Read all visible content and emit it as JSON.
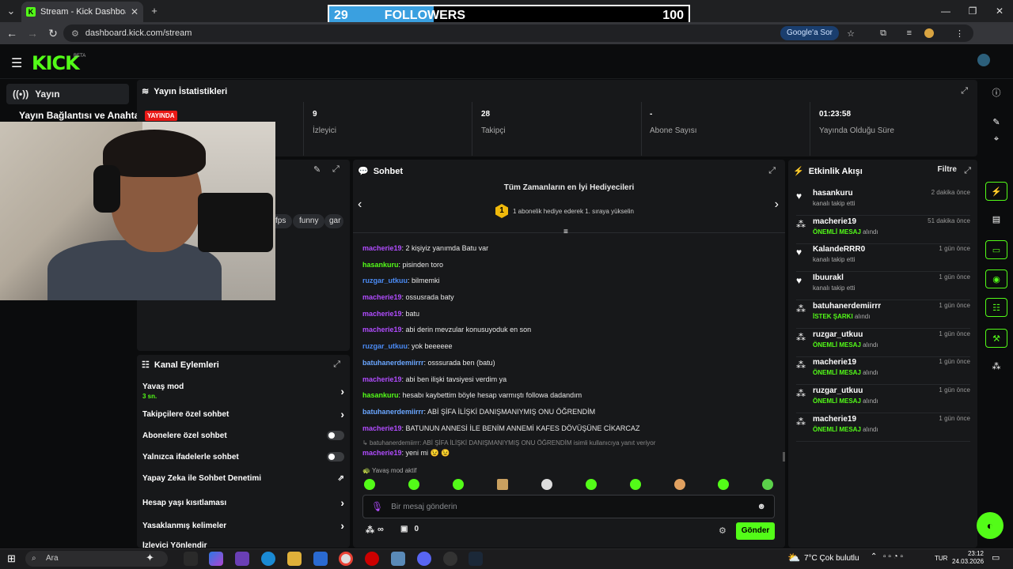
{
  "browser": {
    "tab_title": "Stream - Kick Dashboard",
    "url": "dashboard.kick.com/stream",
    "ask_google": "Google'a Sor"
  },
  "overlay": {
    "current": "29",
    "label": "FOLLOWERS",
    "goal": "100",
    "progress": 0.29
  },
  "kick": {
    "logo": "KICK",
    "beta": "BETA"
  },
  "sidebar": {
    "active": "Yayın",
    "item2": "Yayın Bağlantısı ve Anahtarı"
  },
  "stats": {
    "title": "Yayın İstatistikleri",
    "live_badge": "YAYINDA",
    "viewers_value": "9",
    "viewers_label": "İzleyici",
    "followers_value": "28",
    "followers_label": "Takipçi",
    "subs_value": "-",
    "subs_label": "Abone Sayısı",
    "uptime_value": "01:23:58",
    "uptime_label": "Yayında Olduğu Süre"
  },
  "tags": [
    "fps",
    "funny",
    "gar"
  ],
  "channel_actions": {
    "title": "Kanal Eylemleri",
    "slow_mode": "Yavaş mod",
    "slow_mode_value": "3 sn.",
    "followers_only": "Takipçilere özel sohbet",
    "subs_only": "Abonelere özel sohbet",
    "emotes_only": "Yalnızca ifadelerle sohbet",
    "ai_moderation": "Yapay Zeka ile Sohbet Denetimi",
    "age_restriction": "Hesap yaşı kısıtlaması",
    "banned_words": "Yasaklanmış kelimeler",
    "viewer_management": "İzleyici Yönlendir"
  },
  "chat": {
    "title": "Sohbet",
    "top_gifters": "Tüm Zamanların en İyi Hediyecileri",
    "gift_rank": "1",
    "gift_hint": "1 abonelik hediye ederek 1. sıraya yükselin",
    "messages": [
      {
        "user": "macherie19",
        "text": ": 2 kişiyiz yanımda Batu var",
        "color": "#b14cff"
      },
      {
        "user": "hasankuru",
        "text": ": pisinden toro",
        "color": "#53fc18"
      },
      {
        "user": "ruzgar_utkuu",
        "text": ": bilmemki",
        "color": "#4b8bf5"
      },
      {
        "user": "macherie19",
        "text": ": ossusrada baty",
        "color": "#b14cff"
      },
      {
        "user": "macherie19",
        "text": ": batu",
        "color": "#b14cff"
      },
      {
        "user": "macherie19",
        "text": ": abi derin mevzular konusuyoduk en son",
        "color": "#b14cff"
      },
      {
        "user": "ruzgar_utkuu",
        "text": ": yok beeeeee",
        "color": "#4b8bf5"
      },
      {
        "user": "batuhanerdemiirrr",
        "text": ": osssurada ben (batu)",
        "color": "#6aa6ff"
      },
      {
        "user": "macherie19",
        "text": ": abi ben ilişki tavsiyesi verdim ya",
        "color": "#b14cff"
      },
      {
        "user": "hasankuru",
        "text": ": hesabı kaybettim böyle hesap varmıştı followa dadandım",
        "color": "#53fc18"
      },
      {
        "user": "batuhanerdemiirrr",
        "text": ": ABİ ŞİFA İLİŞKİ DANIŞMANIYMIŞ ONU ÖĞRENDİM",
        "color": "#6aa6ff"
      },
      {
        "user": "macherie19",
        "text": ": BATUNUN ANNESİ İLE BENİM ANNEMİ KAFES DÖVÜŞÜNE CİKARCAZ",
        "color": "#b14cff"
      }
    ],
    "reply_note": "batuhanerdemiirrr: ABİ ŞİFA İLİŞKİ DANIŞMANIYMIŞ ONU ÖĞRENDİM isimli kullanıcıya yanıt veriyor",
    "last_user": "macherie19",
    "last_text": ": yeni mi 😉 😉",
    "slow_mode_notice": "Yavaş mod aktif",
    "placeholder": "Bir mesaj gönderin",
    "points": "∞",
    "count": "0",
    "send": "Gönder"
  },
  "activity": {
    "title": "Etkinlik Akışı",
    "filter": "Filtre",
    "items": [
      {
        "user": "hasankuru",
        "time": "2 dakika önce",
        "pre": "",
        "hl": "",
        "post": "kanalı takip etti",
        "icon": "heart"
      },
      {
        "user": "macherie19",
        "time": "51 dakika önce",
        "pre": "",
        "hl": "ÖNEMLİ MESAJ",
        "post": " alındı",
        "icon": "kicks"
      },
      {
        "user": "KalandeRRR0",
        "time": "1 gün önce",
        "pre": "",
        "hl": "",
        "post": "kanalı takip etti",
        "icon": "heart"
      },
      {
        "user": "Ibuurakl",
        "time": "1 gün önce",
        "pre": "",
        "hl": "",
        "post": "kanalı takip etti",
        "icon": "heart"
      },
      {
        "user": "batuhanerdemiirrr",
        "time": "1 gün önce",
        "pre": "",
        "hl": "İSTEK ŞARKI",
        "post": " alındı",
        "icon": "kicks"
      },
      {
        "user": "ruzgar_utkuu",
        "time": "1 gün önce",
        "pre": "",
        "hl": "ÖNEMLİ MESAJ",
        "post": " alındı",
        "icon": "kicks"
      },
      {
        "user": "macherie19",
        "time": "1 gün önce",
        "pre": "",
        "hl": "ÖNEMLİ MESAJ",
        "post": " alındı",
        "icon": "kicks"
      },
      {
        "user": "ruzgar_utkuu",
        "time": "1 gün önce",
        "pre": "",
        "hl": "ÖNEMLİ MESAJ",
        "post": " alındı",
        "icon": "kicks"
      },
      {
        "user": "macherie19",
        "time": "1 gün önce",
        "pre": "",
        "hl": "ÖNEMLİ MESAJ",
        "post": " alındı",
        "icon": "kicks"
      }
    ]
  },
  "taskbar": {
    "search": "Ara",
    "weather": "7°C  Çok bulutlu",
    "lang": "TUR",
    "time": "23:12",
    "date": "24.03.2026"
  },
  "colors": {
    "accent": "#53fc18",
    "live": "#e91916"
  }
}
